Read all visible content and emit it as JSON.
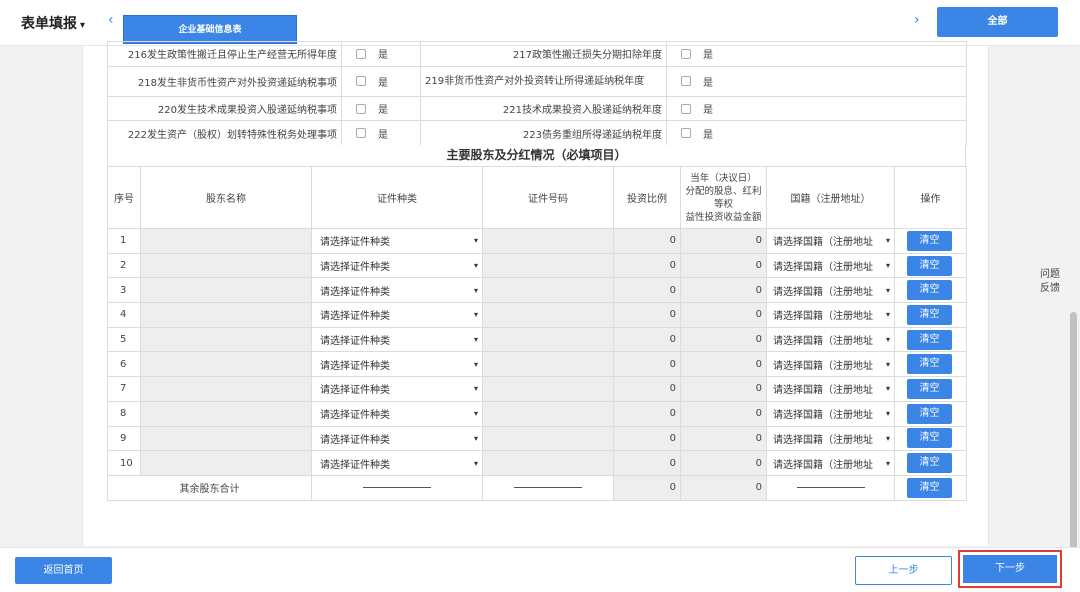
{
  "topbar": {
    "title": "表单填报",
    "title_caret": "▾",
    "prev_glyph": "‹",
    "next_glyph": "›",
    "active_tab": "企业基础信息表",
    "all_button": "全部"
  },
  "questions": [
    {
      "left_label": "216发生政策性搬迁且停止生产经营无所得年度",
      "left_yes": "是",
      "right_label": "217政策性搬迁损失分期扣除年度",
      "right_yes": "是"
    },
    {
      "left_label": "218发生非货币性资产对外投资递延纳税事项",
      "left_yes": "是",
      "right_label": "219非货币性资产对外投资转让所得递延纳税年度",
      "right_yes": "是"
    },
    {
      "left_label": "220发生技术成果投资入股递延纳税事项",
      "left_yes": "是",
      "right_label": "221技术成果投资入股递延纳税年度",
      "right_yes": "是"
    },
    {
      "left_label": "222发生资产（股权）划转特殊性税务处理事项",
      "left_yes": "是",
      "right_label": "223债务重组所得递延纳税年度",
      "right_yes": "是"
    }
  ],
  "shareholders": {
    "section_title": "主要股东及分红情况（必填项目）",
    "headers": {
      "seq": "序号",
      "name": "股东名称",
      "id_type": "证件种类",
      "id_number": "证件号码",
      "ratio": "投资比例",
      "dividend_l1": "当年（决议日）",
      "dividend_l2": "分配的股息、红利",
      "dividend_l3": "等权",
      "dividend_l4": "益性投资收益金额",
      "nationality": "国籍（注册地址）",
      "action": "操作"
    },
    "rows": [
      {
        "seq": "1",
        "id_type": "请选择证件种类",
        "ratio": "0",
        "dividend": "0",
        "nationality": "请选择国籍（注册地址",
        "action": "清空"
      },
      {
        "seq": "2",
        "id_type": "请选择证件种类",
        "ratio": "0",
        "dividend": "0",
        "nationality": "请选择国籍（注册地址",
        "action": "清空"
      },
      {
        "seq": "3",
        "id_type": "请选择证件种类",
        "ratio": "0",
        "dividend": "0",
        "nationality": "请选择国籍（注册地址",
        "action": "清空"
      },
      {
        "seq": "4",
        "id_type": "请选择证件种类",
        "ratio": "0",
        "dividend": "0",
        "nationality": "请选择国籍（注册地址",
        "action": "清空"
      },
      {
        "seq": "5",
        "id_type": "请选择证件种类",
        "ratio": "0",
        "dividend": "0",
        "nationality": "请选择国籍（注册地址",
        "action": "清空"
      },
      {
        "seq": "6",
        "id_type": "请选择证件种类",
        "ratio": "0",
        "dividend": "0",
        "nationality": "请选择国籍（注册地址",
        "action": "清空"
      },
      {
        "seq": "7",
        "id_type": "请选择证件种类",
        "ratio": "0",
        "dividend": "0",
        "nationality": "请选择国籍（注册地址",
        "action": "清空"
      },
      {
        "seq": "8",
        "id_type": "请选择证件种类",
        "ratio": "0",
        "dividend": "0",
        "nationality": "请选择国籍（注册地址",
        "action": "清空"
      },
      {
        "seq": "9",
        "id_type": "请选择证件种类",
        "ratio": "0",
        "dividend": "0",
        "nationality": "请选择国籍（注册地址",
        "action": "清空"
      },
      {
        "seq": "10",
        "id_type": "请选择证件种类",
        "ratio": "0",
        "dividend": "0",
        "nationality": "请选择国籍（注册地址",
        "action": "清空"
      }
    ],
    "select_arrow": "▾",
    "total": {
      "label": "其余股东合计",
      "ratio": "0",
      "dividend": "0",
      "action": "清空"
    }
  },
  "side": {
    "feedback_l1": "问题",
    "feedback_l2": "反馈"
  },
  "footer": {
    "home": "返回首页",
    "prev": "上一步",
    "next": "下一步"
  },
  "colors": {
    "accent": "#3a85e5",
    "highlight": "#e53935"
  }
}
